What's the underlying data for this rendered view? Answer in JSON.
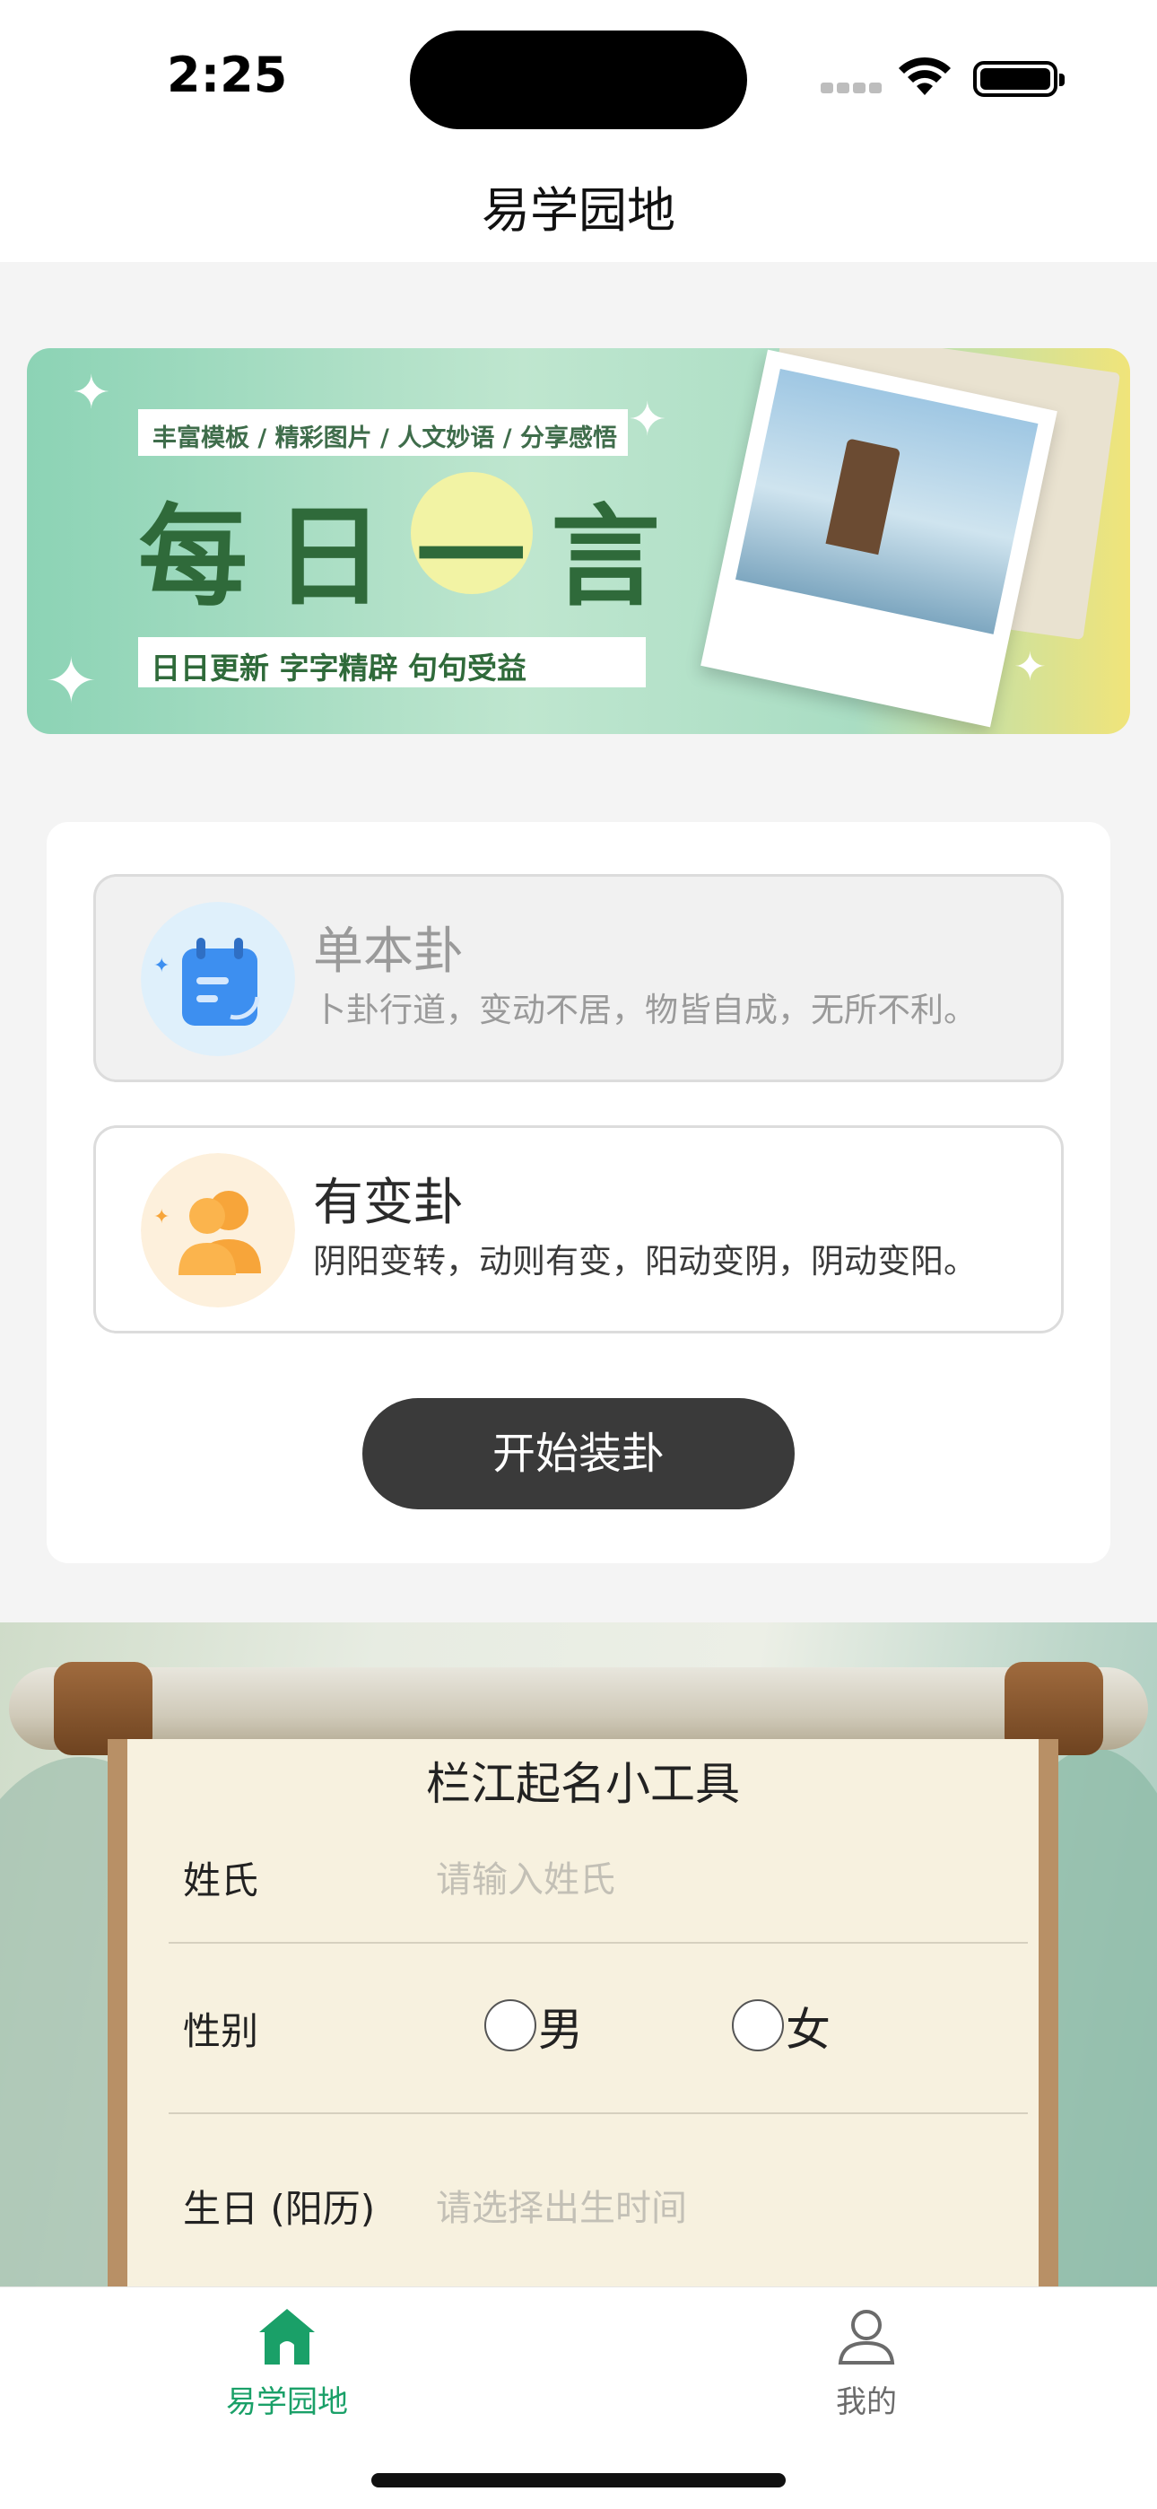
{
  "status_bar": {
    "time": "2:25"
  },
  "nav": {
    "title": "易学园地"
  },
  "banner": {
    "tagline": "丰富模板 / 精彩图片 / 人文妙语 / 分享感悟",
    "heading": [
      "每",
      "日",
      "一",
      "言"
    ],
    "subtitle": "日日更新 字字精辟 句句受益"
  },
  "hexagram_options": [
    {
      "title": "单本卦",
      "description": "卜卦行道，变动不居，物皆自成，无所不利。",
      "selected": true,
      "icon": "calendar-icon"
    },
    {
      "title": "有变卦",
      "description": "阴阳变转，动则有变，阳动变阴，阴动变阳。",
      "selected": false,
      "icon": "users-icon"
    }
  ],
  "start_button": {
    "label": "开始装卦"
  },
  "naming_tool": {
    "title": "栏江起名小工具",
    "surname": {
      "label": "姓氏",
      "placeholder": "请输入姓氏"
    },
    "gender": {
      "label": "性别",
      "options": [
        "男",
        "女"
      ]
    },
    "birthday": {
      "label": "生日 (阳历)",
      "placeholder": "请选择出生时间"
    }
  },
  "tabbar": {
    "items": [
      {
        "label": "易学园地",
        "icon": "home-icon",
        "active": true
      },
      {
        "label": "我的",
        "icon": "user-icon",
        "active": false
      }
    ]
  },
  "colors": {
    "accent": "#1aa068",
    "button_dark": "#3a3a3a"
  }
}
